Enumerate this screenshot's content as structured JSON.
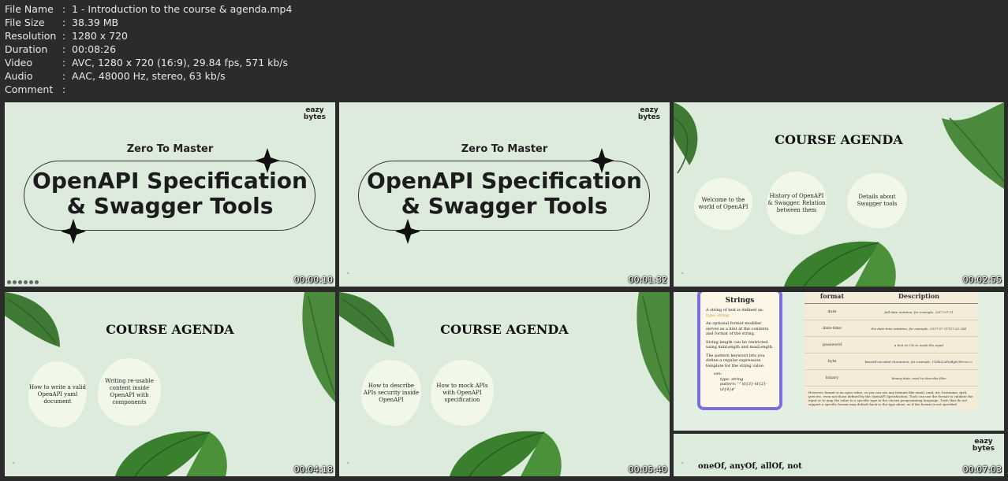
{
  "file_info": [
    {
      "label": "File Name",
      "value": "1 - Introduction to the course & agenda.mp4"
    },
    {
      "label": "File Size",
      "value": "38.39 MB"
    },
    {
      "label": "Resolution",
      "value": "1280 x 720"
    },
    {
      "label": "Duration",
      "value": "00:08:26"
    },
    {
      "label": "Video",
      "value": "AVC, 1280 x 720 (16:9), 29.84 fps, 571 kb/s"
    },
    {
      "label": "Audio",
      "value": "AAC, 48000 Hz, stereo, 63 kb/s"
    },
    {
      "label": "Comment",
      "value": ""
    }
  ],
  "brand": {
    "line1": "eazy",
    "line2": "bytes"
  },
  "title_slide": {
    "kicker": "Zero To Master",
    "title_line1": "OpenAPI Specification",
    "title_line2": "& Swagger Tools"
  },
  "agenda_heading": "COURSE AGENDA",
  "thumbs": [
    {
      "timestamp": "00:00:10"
    },
    {
      "timestamp": "00:01:32"
    },
    {
      "timestamp": "00:02:55",
      "items": [
        "Welcome to the world of OpenAPI",
        "History of OpenAPI & Swagger. Relation between them",
        "Details about Swagger tools"
      ]
    },
    {
      "timestamp": "00:04:18",
      "items": [
        "How to write a valid OpenAPI yaml document",
        "Writing re-usable content inside OpenAPI with components"
      ]
    },
    {
      "timestamp": "00:05:40",
      "items": [
        "How to describe APIs security inside OpenAPI",
        "How to mock APIs with OpenAPI specification"
      ]
    },
    {
      "timestamp": "00:07:03"
    }
  ],
  "strings_slide": {
    "heading": "Strings",
    "p1": "A string of text is defined as:",
    "p1_code": "type: string",
    "p2": "An optional format modifier serves as a hint at the contents and format of the string.",
    "p3": "String length can be restricted using minLength and maxLength.",
    "p4": "The pattern keyword lets you define a regular expression template for the string value.",
    "code_key": "ssn:",
    "code_type": "type: string",
    "code_pattern": "pattern: '^\\d{3}-\\d{2}-\\d{4}$'",
    "table_headers": [
      "format",
      "Description"
    ],
    "table_rows": [
      [
        "date",
        "full-date notation, for example, 2017-07-21"
      ],
      [
        "date-time",
        "the date-time notation, for example, 2017-07-21T17:32:28Z"
      ],
      [
        "password",
        "a hint to UIs to mask the input"
      ],
      [
        "byte",
        "base64-encoded characters, for example, U3dhZ2dlciByb2Nrcw=="
      ],
      [
        "binary",
        "binary data, used to describe files"
      ]
    ],
    "footnote": "However, format is an open value, so you can use any formats like email, uuid, uri, hostname, ipv4, ipv6 etc. even not those defined by the OpenAPI Specification. Tools can use the format to validate the input or to map the value to a specific type in the chosen programming language. Tools that do not support a specific format may default back to the type alone, as if the format is not specified"
  },
  "next_slide_title": "oneOf, anyOf, allOf, not"
}
